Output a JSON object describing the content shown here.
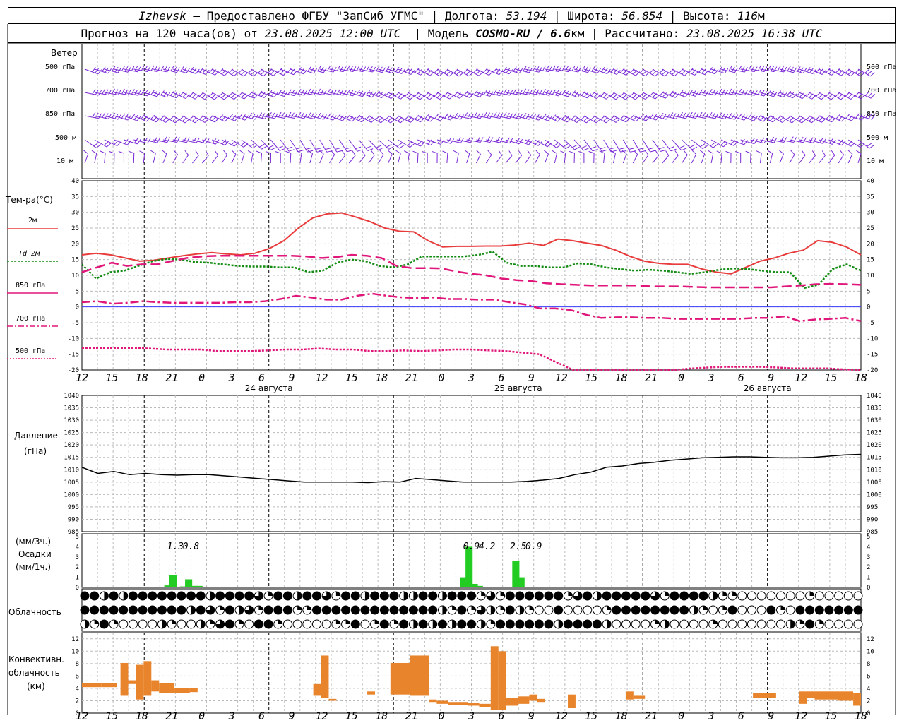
{
  "header": {
    "city": "Izhevsk",
    "provider": "– Предоставлено ФГБУ \"ЗапСиб УГМС\"",
    "lon_label": "Долгота:",
    "lon": "53.194",
    "lat_label": "Широта:",
    "lat": "56.854",
    "alt_label": "Высота:",
    "alt": "116",
    "alt_unit": "м",
    "forecast_prefix": "Прогноз на 120 часа(ов) от",
    "run_time": "23.08.2025 12:00 UTC",
    "model_label": "Модель",
    "model": "COSMO-RU / 6.6",
    "model_unit": "км",
    "calc_label": "Рассчитано:",
    "calc_time": "23.08.2025 16:38 UTC"
  },
  "labels": {
    "wind": "Ветер",
    "wind_levels": [
      "500 гПа",
      "700 гПа",
      "850 гПа",
      "500 м",
      "10  м"
    ],
    "temp": "Тем-ра(°C)",
    "temp_legend": [
      "2м",
      "Td  2м",
      "850 гПа",
      "700 гПа",
      "500 гПа"
    ],
    "pressure": "Давление",
    "pressure_unit": "(гПа)",
    "precip_unit_3h": "(мм/3ч.)",
    "precip": "Осадки",
    "precip_unit_1h": "(мм/1ч.)",
    "cloud": "Облачность",
    "conv": "Конвективн.",
    "conv2": "облачность",
    "conv_unit": "(км)"
  },
  "time_axis": {
    "hour_labels": [
      "12",
      "15",
      "18",
      "21",
      "0",
      "3",
      "6",
      "9",
      "12",
      "15",
      "18",
      "21",
      "0",
      "3",
      "6",
      "9",
      "12",
      "15",
      "18",
      "21",
      "0",
      "3",
      "6",
      "9",
      "12",
      "15",
      "18"
    ],
    "day_labels": [
      "24 августа",
      "25 августа",
      "26 августа"
    ]
  },
  "colors": {
    "t2m": "#e83c3c",
    "td2m": "#138c13",
    "t850": "#e0167a",
    "t700": "#e0167a",
    "t500": "#e0167a",
    "zero_line": "#3c3cff",
    "wind": "#7a28d6",
    "pressure": "#000000",
    "precip": "#22cc22",
    "conv": "#e8852c"
  },
  "chart_data": [
    {
      "type": "line",
      "title": "Тем-ра(°C)",
      "x_hours": [
        0,
        3,
        6,
        9,
        12,
        15,
        18,
        21,
        24,
        27,
        30,
        33,
        36,
        39,
        42,
        45,
        48,
        51,
        54,
        57,
        60,
        63,
        66,
        69,
        72,
        75,
        78,
        81,
        84,
        87,
        90,
        93,
        96,
        99,
        102,
        105,
        108,
        111,
        114,
        117,
        120,
        123,
        126,
        129,
        132,
        135,
        138,
        141,
        144,
        147,
        150,
        153,
        156,
        159
      ],
      "ylim": [
        -20,
        40
      ],
      "series": [
        {
          "name": "2м",
          "values": [
            16.5,
            17,
            16.5,
            15.5,
            14.5,
            14.8,
            15.5,
            16.2,
            16.8,
            17.2,
            16.8,
            16.5,
            17,
            18.5,
            21,
            25,
            28.2,
            29.5,
            29.8,
            28.5,
            27,
            25,
            24,
            23.8,
            21,
            19,
            19.2,
            19.2,
            19.3,
            19.3,
            19.6,
            20.2,
            19.5,
            21.5,
            21,
            20.2,
            19.5,
            18,
            16,
            14.5,
            13.8,
            13.5,
            13.5,
            12,
            11,
            10.5,
            12.5,
            14.5,
            15.5,
            17,
            18,
            21,
            20.5,
            19,
            16.5
          ]
        },
        {
          "name": "Td  2м",
          "values": [
            13.5,
            9,
            11,
            11.5,
            13,
            14.5,
            15.2,
            15,
            14.2,
            14,
            13.5,
            13,
            12.8,
            12.8,
            12.5,
            12.5,
            11,
            11.5,
            14,
            15,
            14.5,
            13,
            12.5,
            13.5,
            16,
            16,
            16,
            16,
            16.5,
            17.5,
            14,
            13,
            13,
            12.5,
            12.5,
            13.8,
            13.5,
            12.5,
            12,
            11.5,
            11.8,
            11.5,
            11,
            10.5,
            11,
            11.8,
            12.2,
            12,
            11.5,
            11,
            11,
            6,
            7,
            12,
            13.5,
            11.5
          ]
        },
        {
          "name": "850 гПа",
          "values": [
            11,
            12.5,
            14,
            13,
            13.5,
            13.5,
            14.5,
            15.5,
            16,
            16.2,
            16.2,
            16.2,
            16.2,
            16.2,
            16.2,
            16,
            15.5,
            15.8,
            16.5,
            16.2,
            15.5,
            13,
            12.3,
            12.3,
            12.2,
            11.2,
            10.5,
            10,
            9,
            8.5,
            8.2,
            7.5,
            7.2,
            7,
            6.8,
            6.8,
            6.8,
            6.8,
            6.5,
            6.5,
            6.5,
            6.3,
            6.2,
            6.2,
            6.2,
            6.2,
            6.2,
            6.5,
            6.8,
            7.2,
            7.3,
            7.2,
            7
          ]
        },
        {
          "name": "700 гПа",
          "values": [
            1.5,
            1.8,
            1,
            1.3,
            1.8,
            1.5,
            1.3,
            1.3,
            1.3,
            1.3,
            1.5,
            1.5,
            1.8,
            2.5,
            3.5,
            3,
            2.3,
            2.3,
            3.5,
            4.2,
            3.5,
            3,
            2.8,
            3,
            2.5,
            2.5,
            2.3,
            2.3,
            1.5,
            0.8,
            -0.5,
            -0.5,
            -1,
            -2.5,
            -3.5,
            -3.3,
            -3.3,
            -3.5,
            -3.5,
            -3.8,
            -3.8,
            -3.8,
            -3.8,
            -3.8,
            -3.5,
            -3.5,
            -3,
            -4.5,
            -4,
            -3.8,
            -3.5,
            -4.5
          ]
        },
        {
          "name": "500 гПа",
          "values": [
            -13,
            -13,
            -13,
            -13,
            -13.2,
            -13.5,
            -13.5,
            -13.5,
            -14,
            -14,
            -14,
            -13.8,
            -13.5,
            -13.5,
            -13.2,
            -13.5,
            -13.5,
            -14,
            -14,
            -13.8,
            -14,
            -13.8,
            -13.5,
            -13.5,
            -13.8,
            -14,
            -14.5,
            -15,
            -17.5,
            -21,
            -21.5,
            -22,
            -22,
            -21.5,
            -21,
            -20.5,
            -19.5,
            -19.2,
            -19,
            -19,
            -19,
            -19.2,
            -19.5,
            -19.5,
            -19.5,
            -19.8,
            -20
          ]
        }
      ],
      "xlabel": "",
      "ylabel": "Тем-ра(°C)"
    },
    {
      "type": "line",
      "title": "Давление",
      "ylim": [
        985,
        1040
      ],
      "series": [
        {
          "name": "Давление",
          "values": [
            1011,
            1008.5,
            1009.3,
            1008,
            1008.5,
            1008,
            1007.8,
            1008,
            1008,
            1007.5,
            1007,
            1006.5,
            1006,
            1005.5,
            1005,
            1005,
            1005,
            1005,
            1004.8,
            1005.2,
            1005,
            1006.5,
            1006,
            1005.5,
            1005,
            1005,
            1005,
            1005,
            1005.3,
            1005.8,
            1006.5,
            1008,
            1009,
            1011,
            1011.5,
            1012.5,
            1013,
            1013.8,
            1014.3,
            1014.8,
            1015,
            1015.2,
            1015.2,
            1015,
            1014.8,
            1014.8,
            1015,
            1015.5,
            1016,
            1016.2
          ]
        }
      ],
      "xlabel": "",
      "ylabel": "(гПа)"
    },
    {
      "type": "bar",
      "title": "Осадки",
      "ylim": [
        0,
        5
      ],
      "series": [
        {
          "name": "мм/1ч.",
          "bars": [
            [
              16,
              0.2
            ],
            [
              17,
              1.2
            ],
            [
              18,
              0.05
            ],
            [
              19,
              0.1
            ],
            [
              20,
              0.8
            ],
            [
              21,
              0.15
            ],
            [
              22,
              0.15
            ],
            [
              73,
              1.0
            ],
            [
              74,
              4.0
            ],
            [
              75,
              0.35
            ],
            [
              76,
              0.15
            ],
            [
              82,
              0.05
            ],
            [
              83,
              2.6
            ],
            [
              84,
              1.0
            ]
          ]
        }
      ],
      "annotations": [
        {
          "h": 18,
          "text": "1.3"
        },
        {
          "h": 21,
          "text": "0.8"
        },
        {
          "h": 75,
          "text": "0.9"
        },
        {
          "h": 78,
          "text": "4.2"
        },
        {
          "h": 84,
          "text": "2.5"
        },
        {
          "h": 87,
          "text": "0.9"
        }
      ]
    },
    {
      "type": "bar",
      "title": "Конвективн. облачность",
      "ylim": [
        0,
        13
      ],
      "series": [
        {
          "name": "конвективная облачность (км)",
          "segments": [
            [
              0,
              5,
              4.2,
              4.8
            ],
            [
              5,
              9,
              4.2,
              4.8
            ],
            [
              10,
              12,
              2.8,
              8.1
            ],
            [
              12,
              14,
              4.7,
              5.3
            ],
            [
              14,
              16,
              2.2,
              7.8
            ],
            [
              16,
              18,
              2.8,
              8.4
            ],
            [
              18,
              20,
              3.5,
              5.3
            ],
            [
              20,
              24,
              3.2,
              4.8
            ],
            [
              24,
              28,
              3.2,
              4
            ],
            [
              28,
              30,
              3.4,
              4
            ],
            [
              60,
              62,
              2.8,
              4.7
            ],
            [
              62,
              64,
              2.5,
              9.3
            ],
            [
              64,
              66,
              2,
              2.3
            ],
            [
              74,
              76,
              3,
              3.5
            ],
            [
              80,
              85,
              3,
              8.1
            ],
            [
              85,
              90,
              2.8,
              9.3
            ],
            [
              90,
              92,
              1.8,
              2.2
            ],
            [
              92,
              95,
              1.5,
              2
            ],
            [
              95,
              100,
              1.3,
              1.8
            ],
            [
              100,
              103,
              1.2,
              1.6
            ],
            [
              103,
              106,
              1.0,
              1.5
            ],
            [
              106,
              108,
              0.5,
              10.8
            ],
            [
              108,
              110,
              0.5,
              10
            ],
            [
              110,
              113,
              1.2,
              2.5
            ],
            [
              113,
              116,
              1.5,
              2.7
            ],
            [
              116,
              118,
              2.0,
              3
            ],
            [
              118,
              120,
              1.8,
              2.3
            ],
            [
              126,
              128,
              0.8,
              3
            ],
            [
              141,
              143,
              2.2,
              3.5
            ],
            [
              143,
              146,
              2.3,
              2.8
            ],
            [
              174,
              180,
              2.5,
              3.3
            ],
            [
              186,
              188,
              1.5,
              3.5
            ],
            [
              188,
              190,
              2.5,
              3.5
            ],
            [
              190,
              196,
              2.2,
              3.5
            ],
            [
              196,
              200,
              2,
              3.5
            ],
            [
              200,
              202,
              1.2,
              3.3
            ]
          ]
        }
      ]
    }
  ]
}
